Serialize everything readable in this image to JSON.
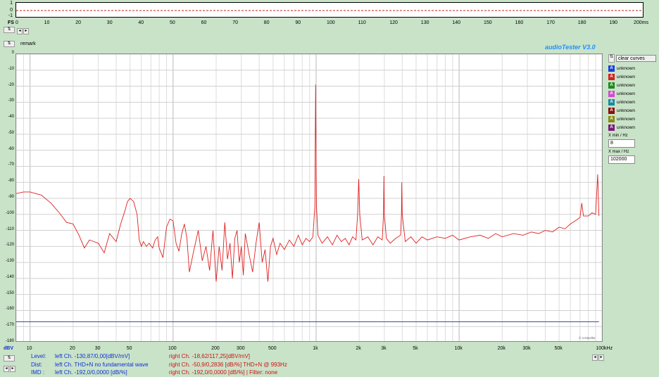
{
  "top_panel": {
    "y_labels": [
      "1",
      "0",
      "-1"
    ],
    "fs_label": "FS",
    "fs_value": "0",
    "time_ticks": [
      "10",
      "20",
      "30",
      "40",
      "50",
      "60",
      "70",
      "80",
      "90",
      "100",
      "110",
      "120",
      "130",
      "140",
      "150",
      "160",
      "170",
      "180",
      "190",
      "200ms"
    ]
  },
  "remark_label": "remark",
  "brand": "audioTester  V3.0",
  "copyright": "© U.Mueller",
  "legend": {
    "clear_label": "clear curves",
    "items": [
      {
        "label": "unknown",
        "color": "#1a3fdb"
      },
      {
        "label": "unknown",
        "color": "#d42020"
      },
      {
        "label": "unknown",
        "color": "#1e8a1e"
      },
      {
        "label": "unknown",
        "color": "#d24bd2"
      },
      {
        "label": "unknown",
        "color": "#1a8aa0"
      },
      {
        "label": "unknown",
        "color": "#8a1010"
      },
      {
        "label": "unknown",
        "color": "#8a8a10"
      },
      {
        "label": "unknown",
        "color": "#7a1a7a"
      }
    ],
    "xmin_label": "X min / Hz",
    "xmin_value": "8",
    "xmax_label": "X max / Hz",
    "xmax_value": "102000"
  },
  "stats": {
    "level_label": "Level:",
    "dist_label": "Dist:",
    "imd_label": "IMD  :",
    "level_left": "left Ch. -130,87/0,00[dBV/mV]",
    "level_right": "right Ch. -18,62/117,25[dBV/mV]",
    "dist_left": "left Ch. THD+N  no fundamental wave",
    "dist_right": "right Ch. -50,9/0,2836 [dB/%] THD+N  @ 993Hz",
    "imd_left": "left Ch. -192,0/0,0000 [dB/%]",
    "imd_right": "right Ch. -192,0/0,0000 [dB/%] |   Filter: none"
  },
  "chart_data": {
    "type": "line",
    "x_scale": "log",
    "xlim": [
      8,
      102000
    ],
    "ylim": [
      -180,
      0
    ],
    "grid": true,
    "ylabel": "dBV",
    "y_ticks": [
      "0",
      "-10",
      "-20",
      "-30",
      "-40",
      "-50",
      "-60",
      "-70",
      "-80",
      "-90",
      "-100",
      "-110",
      "-120",
      "-130",
      "-140",
      "-150",
      "-160",
      "-170",
      "-180"
    ],
    "x_tick_labels": [
      {
        "v": 10,
        "t": "10"
      },
      {
        "v": 20,
        "t": "20"
      },
      {
        "v": 30,
        "t": "30"
      },
      {
        "v": 50,
        "t": "50"
      },
      {
        "v": 100,
        "t": "100"
      },
      {
        "v": 200,
        "t": "200"
      },
      {
        "v": 300,
        "t": "300"
      },
      {
        "v": 500,
        "t": "500"
      },
      {
        "v": 1000,
        "t": "1k"
      },
      {
        "v": 2000,
        "t": "2k"
      },
      {
        "v": 3000,
        "t": "3k"
      },
      {
        "v": 5000,
        "t": "5k"
      },
      {
        "v": 10000,
        "t": "10k"
      },
      {
        "v": 20000,
        "t": "20k"
      },
      {
        "v": 30000,
        "t": "30k"
      },
      {
        "v": 50000,
        "t": "50k"
      },
      {
        "v": 100000,
        "t": "100kHz"
      }
    ],
    "series": [
      {
        "color": "#e02020",
        "points": [
          [
            8,
            -87
          ],
          [
            9,
            -86
          ],
          [
            10,
            -86
          ],
          [
            12,
            -88
          ],
          [
            14,
            -93
          ],
          [
            16,
            -99
          ],
          [
            18,
            -105
          ],
          [
            20,
            -106
          ],
          [
            22,
            -113
          ],
          [
            24,
            -121
          ],
          [
            26,
            -116
          ],
          [
            28,
            -117
          ],
          [
            30,
            -118
          ],
          [
            33,
            -124
          ],
          [
            36,
            -112
          ],
          [
            40,
            -117
          ],
          [
            43,
            -106
          ],
          [
            46,
            -98
          ],
          [
            48,
            -92
          ],
          [
            50,
            -90
          ],
          [
            53,
            -92
          ],
          [
            56,
            -100
          ],
          [
            58,
            -116
          ],
          [
            60,
            -120
          ],
          [
            62,
            -117
          ],
          [
            65,
            -120
          ],
          [
            68,
            -118
          ],
          [
            72,
            -121
          ],
          [
            75,
            -116
          ],
          [
            78,
            -114
          ],
          [
            80,
            -121
          ],
          [
            85,
            -127
          ],
          [
            90,
            -108
          ],
          [
            95,
            -103
          ],
          [
            100,
            -104
          ],
          [
            105,
            -118
          ],
          [
            110,
            -123
          ],
          [
            115,
            -112
          ],
          [
            120,
            -106
          ],
          [
            125,
            -115
          ],
          [
            130,
            -136
          ],
          [
            140,
            -122
          ],
          [
            150,
            -110
          ],
          [
            160,
            -129
          ],
          [
            170,
            -120
          ],
          [
            180,
            -135
          ],
          [
            190,
            -110
          ],
          [
            200,
            -142
          ],
          [
            210,
            -120
          ],
          [
            220,
            -135
          ],
          [
            230,
            -105
          ],
          [
            240,
            -128
          ],
          [
            250,
            -118
          ],
          [
            260,
            -140
          ],
          [
            270,
            -115
          ],
          [
            280,
            -110
          ],
          [
            290,
            -130
          ],
          [
            300,
            -120
          ],
          [
            310,
            -138
          ],
          [
            320,
            -112
          ],
          [
            340,
            -125
          ],
          [
            360,
            -136
          ],
          [
            380,
            -118
          ],
          [
            400,
            -105
          ],
          [
            420,
            -130
          ],
          [
            440,
            -122
          ],
          [
            460,
            -142
          ],
          [
            480,
            -120
          ],
          [
            500,
            -115
          ],
          [
            530,
            -125
          ],
          [
            560,
            -118
          ],
          [
            600,
            -122
          ],
          [
            650,
            -116
          ],
          [
            700,
            -120
          ],
          [
            750,
            -113
          ],
          [
            800,
            -119
          ],
          [
            850,
            -115
          ],
          [
            900,
            -117
          ],
          [
            950,
            -114
          ],
          [
            980,
            -95
          ],
          [
            993,
            -19
          ],
          [
            1006,
            -95
          ],
          [
            1030,
            -113
          ],
          [
            1100,
            -118
          ],
          [
            1200,
            -114
          ],
          [
            1300,
            -119
          ],
          [
            1400,
            -113
          ],
          [
            1500,
            -117
          ],
          [
            1600,
            -115
          ],
          [
            1700,
            -119
          ],
          [
            1800,
            -114
          ],
          [
            1900,
            -116
          ],
          [
            1950,
            -100
          ],
          [
            1986,
            -78
          ],
          [
            2020,
            -100
          ],
          [
            2100,
            -116
          ],
          [
            2300,
            -114
          ],
          [
            2500,
            -119
          ],
          [
            2700,
            -114
          ],
          [
            2900,
            -116
          ],
          [
            2960,
            -100
          ],
          [
            2979,
            -76
          ],
          [
            3000,
            -100
          ],
          [
            3100,
            -115
          ],
          [
            3300,
            -118
          ],
          [
            3600,
            -115
          ],
          [
            3900,
            -113
          ],
          [
            3950,
            -100
          ],
          [
            3972,
            -80
          ],
          [
            4000,
            -100
          ],
          [
            4200,
            -117
          ],
          [
            4600,
            -114
          ],
          [
            5000,
            -118
          ],
          [
            5500,
            -114
          ],
          [
            6000,
            -116
          ],
          [
            7000,
            -114
          ],
          [
            8000,
            -115
          ],
          [
            9000,
            -113
          ],
          [
            10000,
            -116
          ],
          [
            12000,
            -114
          ],
          [
            14000,
            -113
          ],
          [
            16000,
            -115
          ],
          [
            18000,
            -112
          ],
          [
            20000,
            -114
          ],
          [
            24000,
            -112
          ],
          [
            28000,
            -113
          ],
          [
            32000,
            -111
          ],
          [
            36000,
            -112
          ],
          [
            40000,
            -110
          ],
          [
            45000,
            -111
          ],
          [
            50000,
            -108
          ],
          [
            55000,
            -109
          ],
          [
            60000,
            -106
          ],
          [
            65000,
            -104
          ],
          [
            70000,
            -102
          ],
          [
            72000,
            -93
          ],
          [
            74000,
            -101
          ],
          [
            80000,
            -101
          ],
          [
            85000,
            -99
          ],
          [
            90000,
            -100
          ],
          [
            93000,
            -75
          ],
          [
            95000,
            -101
          ]
        ]
      },
      {
        "color": "#2030a0",
        "points": [
          [
            8,
            -167
          ],
          [
            95000,
            -167
          ]
        ]
      }
    ]
  }
}
